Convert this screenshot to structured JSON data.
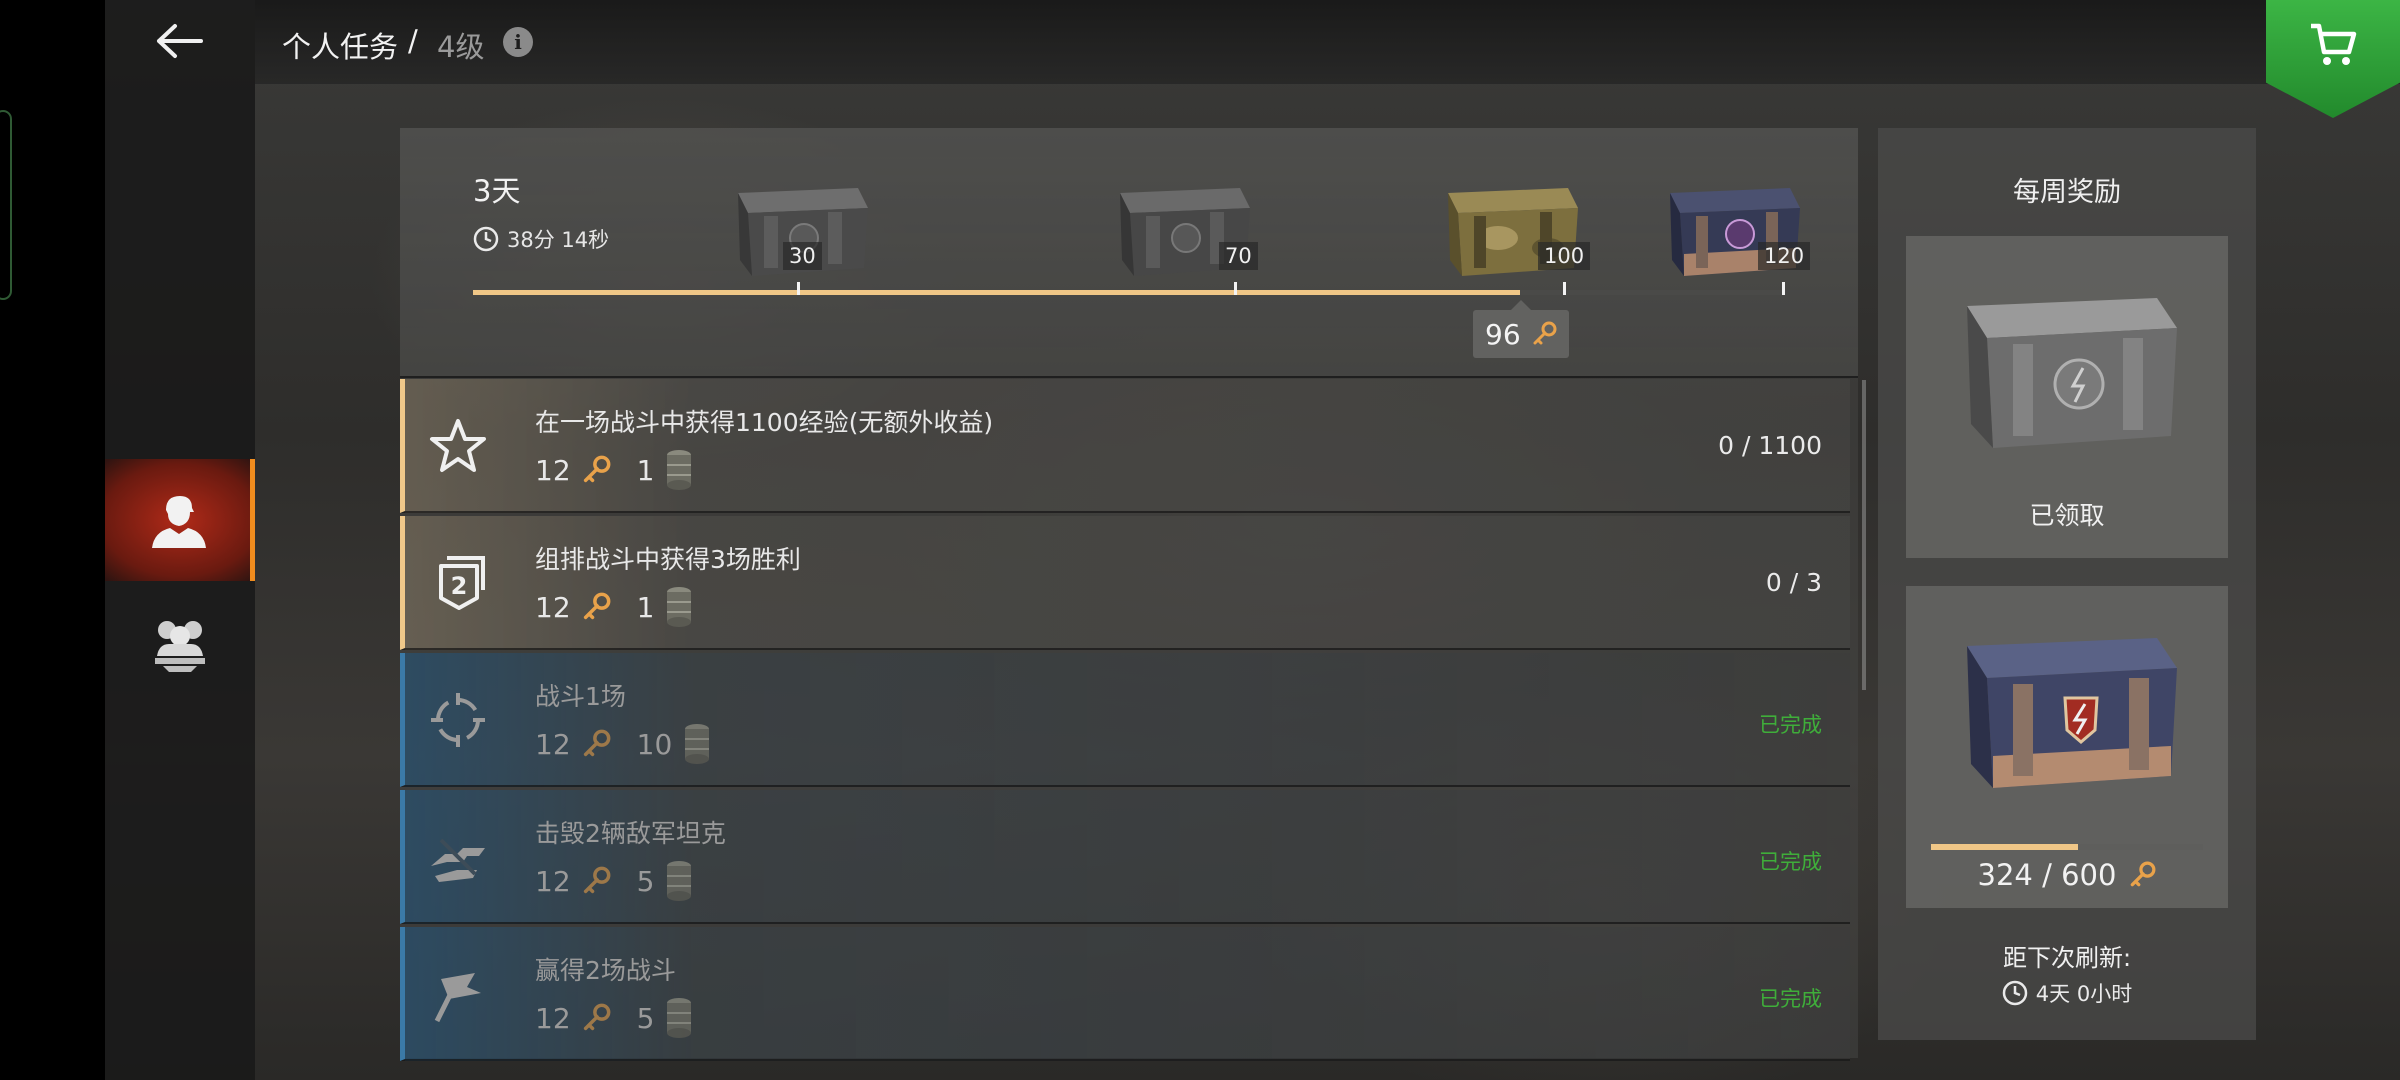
{
  "header": {
    "breadcrumb_section": "个人任务",
    "breadcrumb_separator": "/",
    "breadcrumb_level": "4级",
    "info_glyph": "i"
  },
  "sidebar": {
    "tabs": [
      {
        "name": "personal-missions",
        "icon": "soldier-avatar-icon",
        "active": true
      },
      {
        "name": "clan-missions",
        "icon": "group-icon",
        "active": false
      }
    ]
  },
  "progress": {
    "days_left": "3天",
    "timer": "38分 14秒",
    "current_points": "96",
    "current_value": 96,
    "max_value": 120,
    "milestones": [
      {
        "value": 30,
        "label": "30",
        "chest": "gray-chest"
      },
      {
        "value": 70,
        "label": "70",
        "chest": "gray-chest"
      },
      {
        "value": 100,
        "label": "100",
        "chest": "camo-chest"
      },
      {
        "value": 120,
        "label": "120",
        "chest": "blue-chest"
      }
    ]
  },
  "tasks": [
    {
      "title": "在一场战斗中获得1100经验(无额外收益)",
      "keys": "12",
      "barrels": "1",
      "progress": "0 / 1100",
      "status": "",
      "icon": "star-icon",
      "state": "active"
    },
    {
      "title": "组排战斗中获得3场胜利",
      "keys": "12",
      "barrels": "1",
      "progress": "0 / 3",
      "status": "",
      "icon": "platoon-badge-icon",
      "state": "active"
    },
    {
      "title": "战斗1场",
      "keys": "12",
      "barrels": "10",
      "progress": "",
      "status": "已完成",
      "icon": "crosshair-icon",
      "state": "done"
    },
    {
      "title": "击毁2辆敌军坦克",
      "keys": "12",
      "barrels": "5",
      "progress": "",
      "status": "已完成",
      "icon": "destroyed-tank-icon",
      "state": "done"
    },
    {
      "title": "赢得2场战斗",
      "keys": "12",
      "barrels": "5",
      "progress": "",
      "status": "已完成",
      "icon": "flag-icon",
      "state": "done"
    }
  ],
  "weekly": {
    "title": "每周奖励",
    "claimed_label": "已领取",
    "points": "324 / 600",
    "points_value": 324,
    "points_max": 600,
    "refresh_label": "距下次刷新:",
    "refresh_time": "4天 0小时"
  },
  "colors": {
    "accent_gold": "#f0c787",
    "active_tab": "#b02a18",
    "active_border": "#f08c1e",
    "done_green": "#3fae3a",
    "done_blue": "#3b7aa7",
    "shop_green": "#2ea238",
    "key_orange": "#e9a24a"
  }
}
